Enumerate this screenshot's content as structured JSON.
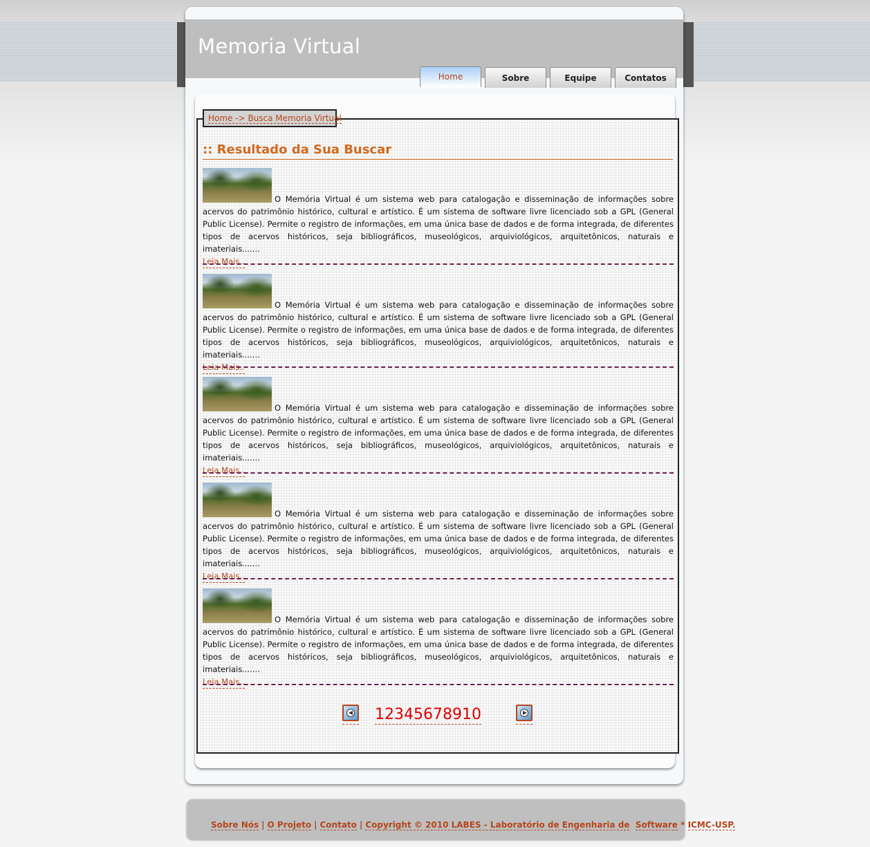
{
  "site": {
    "title": "Memoria Virtual"
  },
  "nav": {
    "tabs": [
      {
        "label": "Home",
        "active": true
      },
      {
        "label": "Sobre",
        "active": false
      },
      {
        "label": "Equipe",
        "active": false
      },
      {
        "label": "Contatos",
        "active": false
      }
    ]
  },
  "breadcrumb": {
    "text": "Home -> Busca Memoria Virtual"
  },
  "results": {
    "title": ":: Resultado da Sua Buscar",
    "items": [
      {
        "text": "O Memória Virtual é um sistema web para catalogação e disseminação de informações sobre acervos do patrimônio histórico, cultural e artístico. É um sistema de software livre licenciado sob a GPL (General Public License). Permite o registro de informações, em uma única base de dados e de forma integrada, de diferentes tipos de acervos históricos, seja bibliográficos, museológicos, arquiviológicos, arquitetônicos, naturais e imateriais.......",
        "read_more": "Leia Mais.."
      },
      {
        "text": "O Memória Virtual é um sistema web para catalogação e disseminação de informações sobre acervos do patrimônio histórico, cultural e artístico. É um sistema de software livre licenciado sob a GPL (General Public License). Permite o registro de informações, em uma única base de dados e de forma integrada, de diferentes tipos de acervos históricos, seja bibliográficos, museológicos, arquiviológicos, arquitetônicos, naturais e imateriais.......",
        "read_more": "Leia Mais.."
      },
      {
        "text": "O Memória Virtual é um sistema web para catalogação e disseminação de informações sobre acervos do patrimônio histórico, cultural e artístico. É um sistema de software livre licenciado sob a GPL (General Public License). Permite o registro de informações, em uma única base de dados e de forma integrada, de diferentes tipos de acervos históricos, seja bibliográficos, museológicos, arquiviológicos, arquitetônicos, naturais e imateriais.......",
        "read_more": "Leia Mais.."
      },
      {
        "text": "O Memória Virtual é um sistema web para catalogação e disseminação de informações sobre acervos do patrimônio histórico, cultural e artístico. É um sistema de software livre licenciado sob a GPL (General Public License). Permite o registro de informações, em uma única base de dados e de forma integrada, de diferentes tipos de acervos históricos, seja bibliográficos, museológicos, arquiviológicos, arquitetônicos, naturais e imateriais.......",
        "read_more": "Leia Mais.."
      },
      {
        "text": "O Memória Virtual é um sistema web para catalogação e disseminação de informações sobre acervos do patrimônio histórico, cultural e artístico. É um sistema de software livre licenciado sob a GPL (General Public License). Permite o registro de informações, em uma única base de dados e de forma integrada, de diferentes tipos de acervos históricos, seja bibliográficos, museológicos, arquiviológicos, arquitetônicos, naturais e imateriais.......",
        "read_more": "Leia Mais.."
      }
    ]
  },
  "pager": {
    "pages": [
      "1",
      "2",
      "3",
      "4",
      "5",
      "6",
      "7",
      "8",
      "9",
      "10"
    ],
    "prev_icon": "arrow-left-icon",
    "next_icon": "arrow-right-icon"
  },
  "footer": {
    "links": [
      "Sobre Nós",
      "O Projeto",
      "Contato"
    ],
    "copyright": "Copyright © 2010 LABES - Laboratório de Engenharia de",
    "copyright_link": "Software",
    "separator": " * ",
    "org_link": "ICMC-USP."
  },
  "colors": {
    "accent": "#b5451b",
    "title": "#d2691e",
    "divider": "#6b1e4a",
    "pager_numbers": "#e00000",
    "header": "#bebebe"
  }
}
